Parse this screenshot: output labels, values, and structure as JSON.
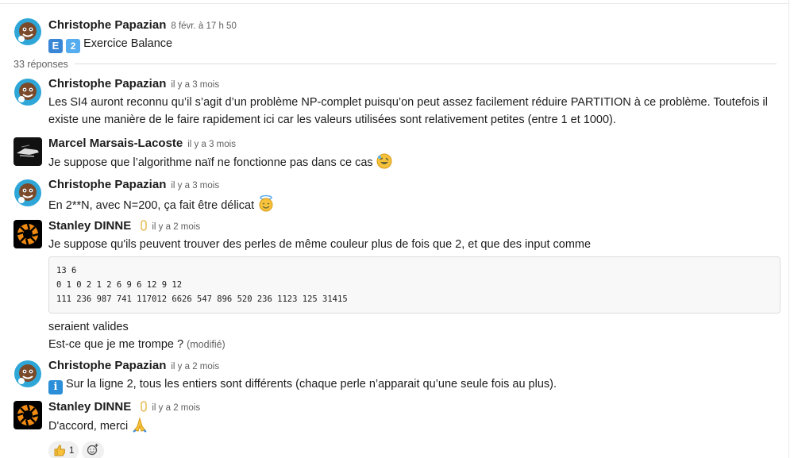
{
  "thread": {
    "parent": {
      "author": "Christophe Papazian",
      "time": "8 févr. à 17 h 50",
      "text": "Exercice Balance",
      "badges": [
        "E",
        "2"
      ]
    },
    "replies_label": "33 réponses",
    "messages": [
      {
        "author": "Christophe Papazian",
        "time": "il y a 3 mois",
        "lines": [
          "Les SI4 auront reconnu qu’il s’agit d’un problème NP-complet puisqu’on peut assez facilement réduire PARTITION à ce problème. Toutefois il",
          "existe une manière de le faire rapidement ici car les valeurs utilisées sont relativement petites (entre 1 et 1000)."
        ]
      },
      {
        "author": "Marcel Marsais-Lacoste",
        "time": "il y a 3 mois",
        "text": "Je suppose que l’algorithme naïf ne fonctionne pas dans ce cas",
        "emoji": "rofl"
      },
      {
        "author": "Christophe Papazian",
        "time": "il y a 3 mois",
        "text": "En 2**N, avec N=200, ça fait être délicat",
        "emoji": "innocent"
      },
      {
        "author": "Stanley DINNE",
        "time": "il y a 2 mois",
        "text": "Je suppose qu'ils peuvent trouver des perles de même couleur plus de fois que 2, et que des input comme",
        "code": [
          "13 6",
          "0 1 0 2 1 2 6 9 6 12 9 12",
          "111 236 987 741 117012 6626 547 896 520 236 1123 125 31415"
        ],
        "after": "seraient valides",
        "after2": "Est-ce que je me trompe ?",
        "edited": "(modifié)"
      },
      {
        "author": "Christophe Papazian",
        "time": "il y a 2 mois",
        "text": "Sur la ligne 2, tous les entiers sont différents (chaque perle n’apparait qu’une seule fois au plus).",
        "badge": "i"
      },
      {
        "author": "Stanley DINNE",
        "time": "il y a 2 mois",
        "text": "D'accord, merci",
        "emoji": "pray",
        "reaction": {
          "emoji": "thumbs-up",
          "count": "1"
        }
      }
    ]
  }
}
